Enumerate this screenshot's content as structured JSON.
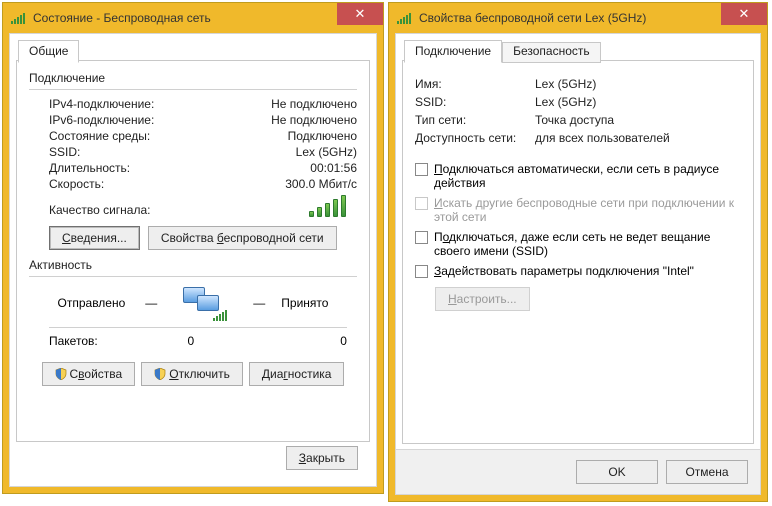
{
  "left": {
    "title": "Состояние - Беспроводная сеть",
    "tab": "Общие",
    "group_connection": "Подключение",
    "ipv4_label": "IPv4-подключение:",
    "ipv4_value": "Не подключено",
    "ipv6_label": "IPv6-подключение:",
    "ipv6_value": "Не подключено",
    "media_label": "Состояние среды:",
    "media_value": "Подключено",
    "ssid_label": "SSID:",
    "ssid_value": "Lex (5GHz)",
    "duration_label": "Длительность:",
    "duration_value": "00:01:56",
    "speed_label": "Скорость:",
    "speed_value": "300.0 Мбит/с",
    "signal_label": "Качество сигнала:",
    "details_btn": "Сведения...",
    "wireless_props_btn": "Свойства беспроводной сети",
    "group_activity": "Активность",
    "sent_label": "Отправлено",
    "received_label": "Принято",
    "packets_label": "Пакетов:",
    "sent_value": "0",
    "received_value": "0",
    "props_btn": "Свойства",
    "disconnect_btn": "Отключить",
    "diag_btn": "Диагностика",
    "close_btn": "Закрыть"
  },
  "right": {
    "title": "Свойства беспроводной сети Lex (5GHz)",
    "tab_connection": "Подключение",
    "tab_security": "Безопасность",
    "name_label": "Имя:",
    "name_value": "Lex (5GHz)",
    "ssid_label": "SSID:",
    "ssid_value": "Lex (5GHz)",
    "nettype_label": "Тип сети:",
    "nettype_value": "Точка доступа",
    "avail_label": "Доступность сети:",
    "avail_value": "для всех пользователей",
    "chk_auto": "Подключаться автоматически, если сеть в радиусе действия",
    "chk_other": "Искать другие беспроводные сети при подключении к этой сети",
    "chk_hidden": "Подключаться, даже если сеть не ведет вещание своего имени (SSID)",
    "chk_intel": "Задействовать параметры подключения \"Intel\"",
    "configure_btn": "Настроить...",
    "ok_btn": "OK",
    "cancel_btn": "Отмена"
  }
}
